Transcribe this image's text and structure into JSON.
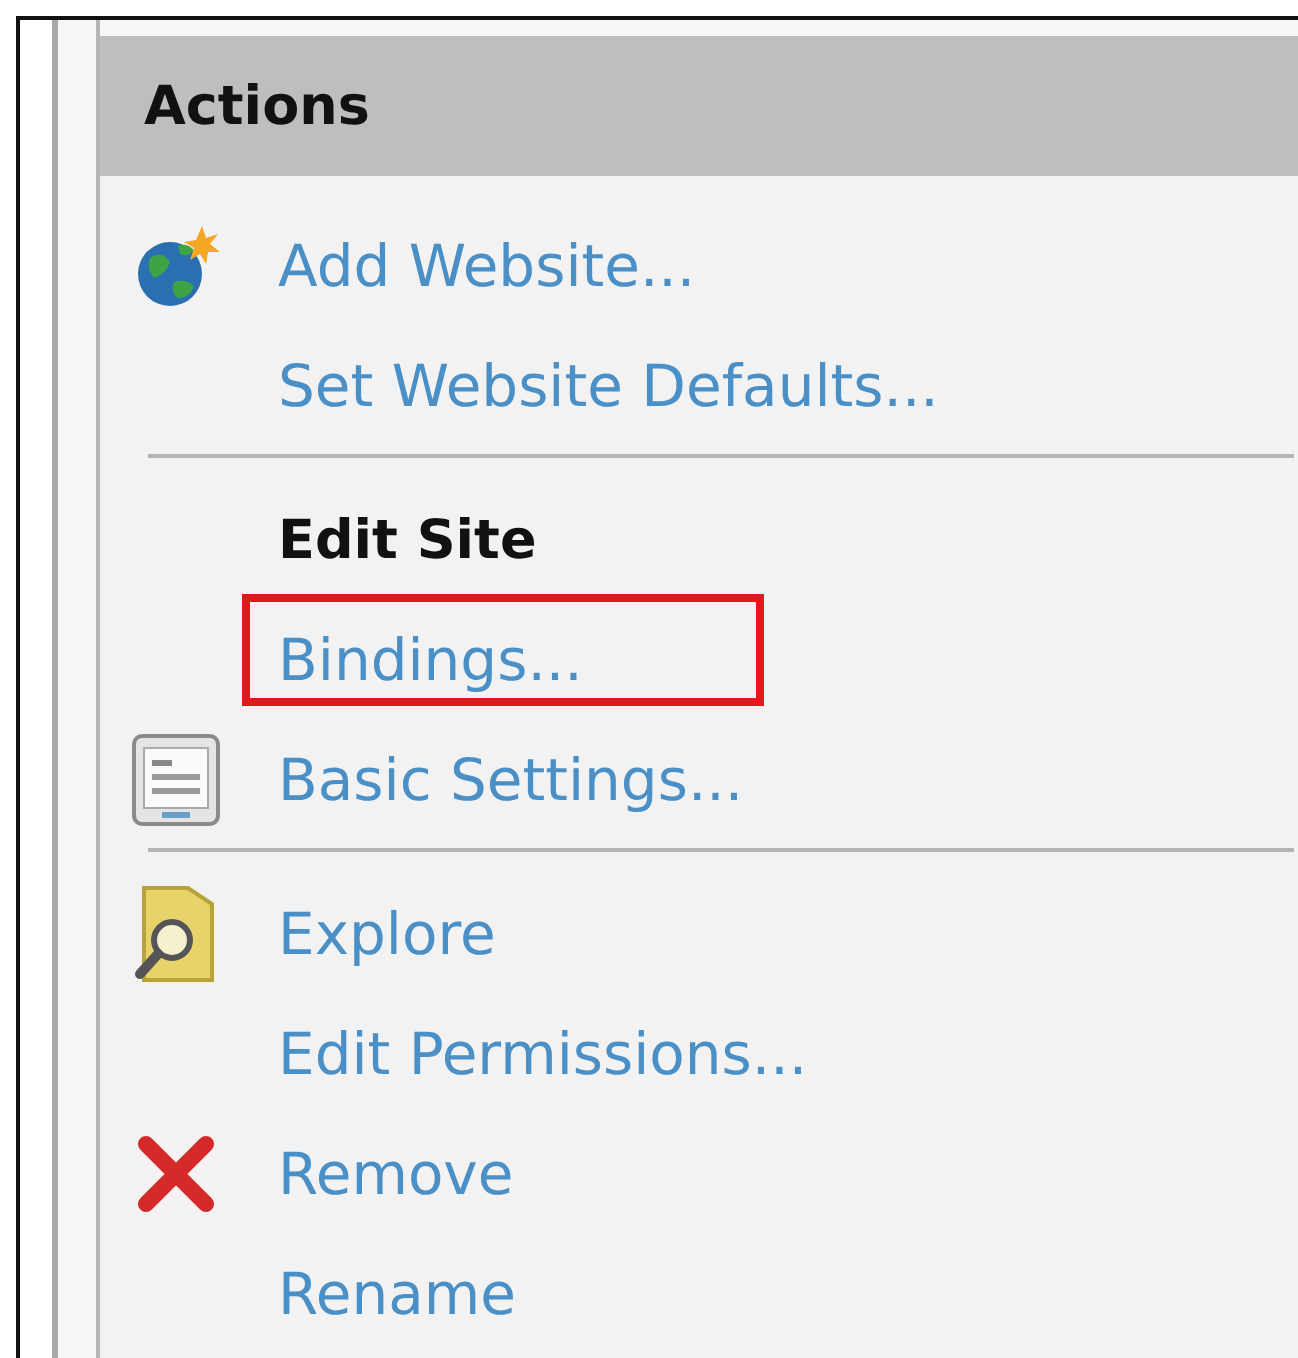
{
  "panel": {
    "title": "Actions"
  },
  "items": [
    {
      "kind": "add",
      "label": "Add Website...",
      "highlighted": false
    },
    {
      "kind": "action",
      "label": "Set Website Defaults...",
      "highlighted": false
    },
    {
      "kind": "separator"
    },
    {
      "kind": "heading",
      "label": "Edit Site"
    },
    {
      "kind": "action",
      "label": "Bindings...",
      "highlighted": true
    },
    {
      "kind": "settings",
      "label": "Basic Settings...",
      "highlighted": false
    },
    {
      "kind": "separator"
    },
    {
      "kind": "explore",
      "label": "Explore",
      "highlighted": false
    },
    {
      "kind": "action",
      "label": "Edit Permissions...",
      "highlighted": false
    },
    {
      "kind": "remove",
      "label": "Remove",
      "highlighted": false
    },
    {
      "kind": "action",
      "label": "Rename",
      "highlighted": false
    }
  ]
}
